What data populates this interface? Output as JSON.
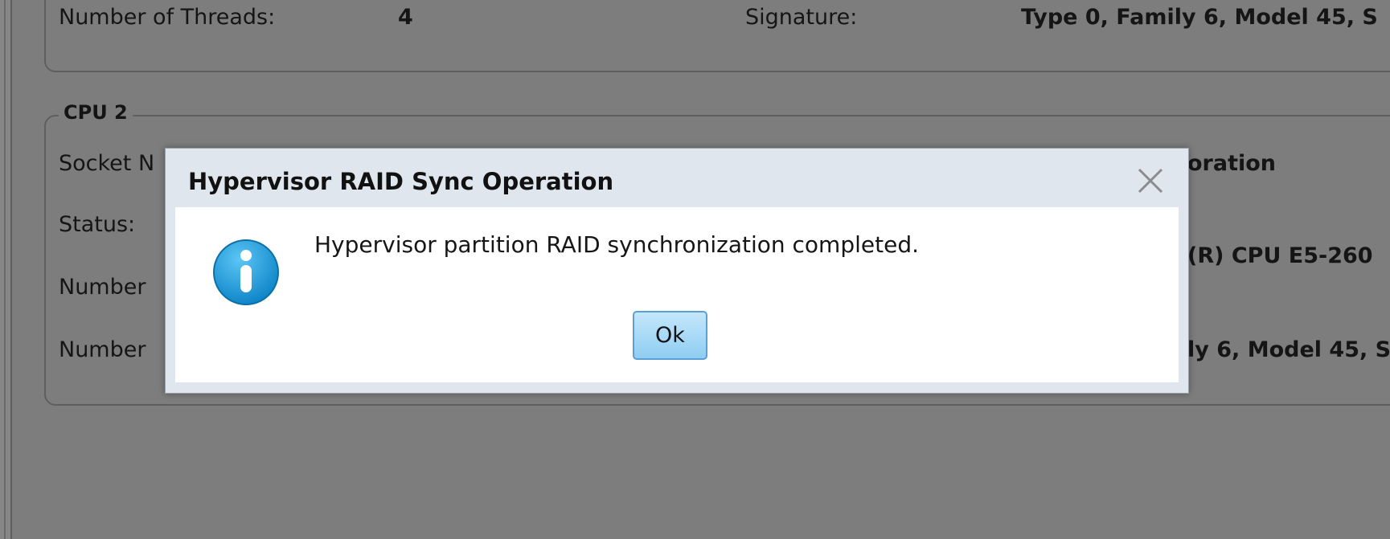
{
  "background": {
    "cpu1_fields": {
      "threads_label": "Number of Threads:",
      "threads_value": "4",
      "signature_label": "Signature:",
      "signature_value": "Type 0, Family 6, Model 45, S"
    },
    "cpu2": {
      "title": "CPU 2",
      "socket_label": "Socket N",
      "status_label": "Status:",
      "number_label_1": "Number",
      "number_label_2": "Number",
      "right_value_1": "oration",
      "right_value_2": "(R) CPU E5-260",
      "right_value_3": "ly 6, Model 45, S"
    }
  },
  "dialog": {
    "title": "Hypervisor RAID Sync Operation",
    "message": "Hypervisor partition RAID synchronization completed.",
    "ok_label": "Ok",
    "close_icon": "close-icon",
    "info_icon": "info-icon"
  },
  "colors": {
    "overlay": "#7d7d7d",
    "dialog_header": "#dfe6ed",
    "button_fill": "#9fd6f5",
    "button_border": "#5aa0d4",
    "info_icon": "#1f9fe0"
  }
}
